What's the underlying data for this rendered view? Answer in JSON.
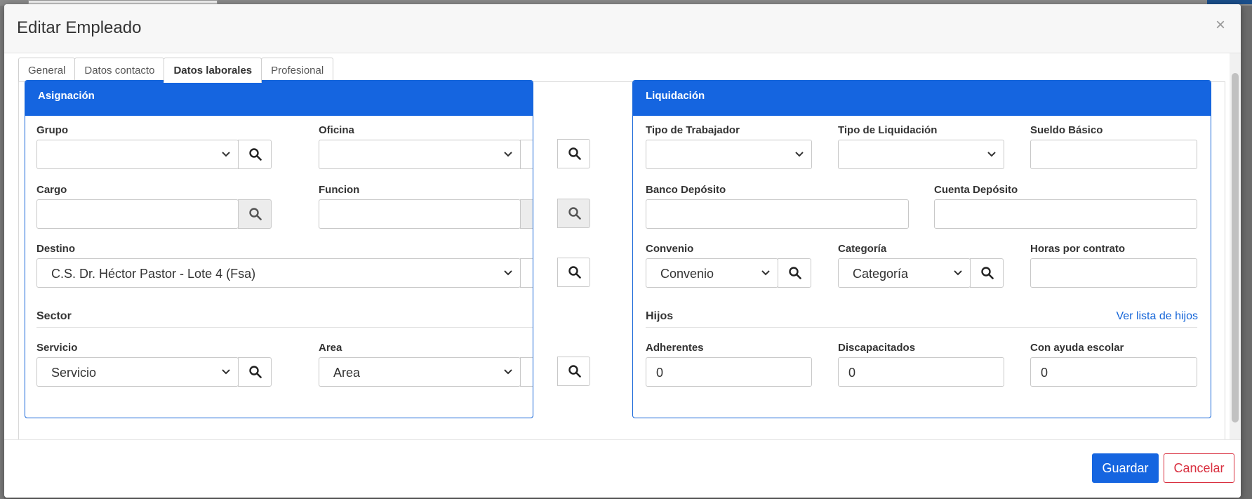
{
  "modal": {
    "title": "Editar Empleado",
    "close_symbol": "×"
  },
  "tabs": [
    {
      "label": "General"
    },
    {
      "label": "Datos contacto"
    },
    {
      "label": "Datos laborales"
    },
    {
      "label": "Profesional"
    }
  ],
  "asignacion": {
    "title": "Asignación",
    "grupo_label": "Grupo",
    "oficina_label": "Oficina",
    "cargo_label": "Cargo",
    "funcion_label": "Funcion",
    "destino_label": "Destino",
    "destino_value": "C.S. Dr. Héctor Pastor - Lote 4 (Fsa)",
    "sector_title": "Sector",
    "servicio_label": "Servicio",
    "servicio_value": "Servicio",
    "area_label": "Area",
    "area_value": "Area"
  },
  "liquidacion": {
    "title": "Liquidación",
    "tipo_trabajador_label": "Tipo de Trabajador",
    "tipo_liquidacion_label": "Tipo de Liquidación",
    "sueldo_label": "Sueldo Básico",
    "banco_label": "Banco Depósito",
    "cuenta_label": "Cuenta Depósito",
    "convenio_label": "Convenio",
    "convenio_value": "Convenio",
    "categoria_label": "Categoría",
    "categoria_value": "Categoría",
    "horas_label": "Horas por contrato",
    "hijos_title": "Hijos",
    "ver_hijos_link": "Ver lista de hijos",
    "adherentes_label": "Adherentes",
    "adherentes_value": "0",
    "discapacitados_label": "Discapacitados",
    "discapacitados_value": "0",
    "ayuda_label": "Con ayuda escolar",
    "ayuda_value": "0"
  },
  "footer": {
    "save_label": "Guardar",
    "cancel_label": "Cancelar"
  },
  "colors": {
    "primary": "#1565e0",
    "danger": "#d93040"
  }
}
